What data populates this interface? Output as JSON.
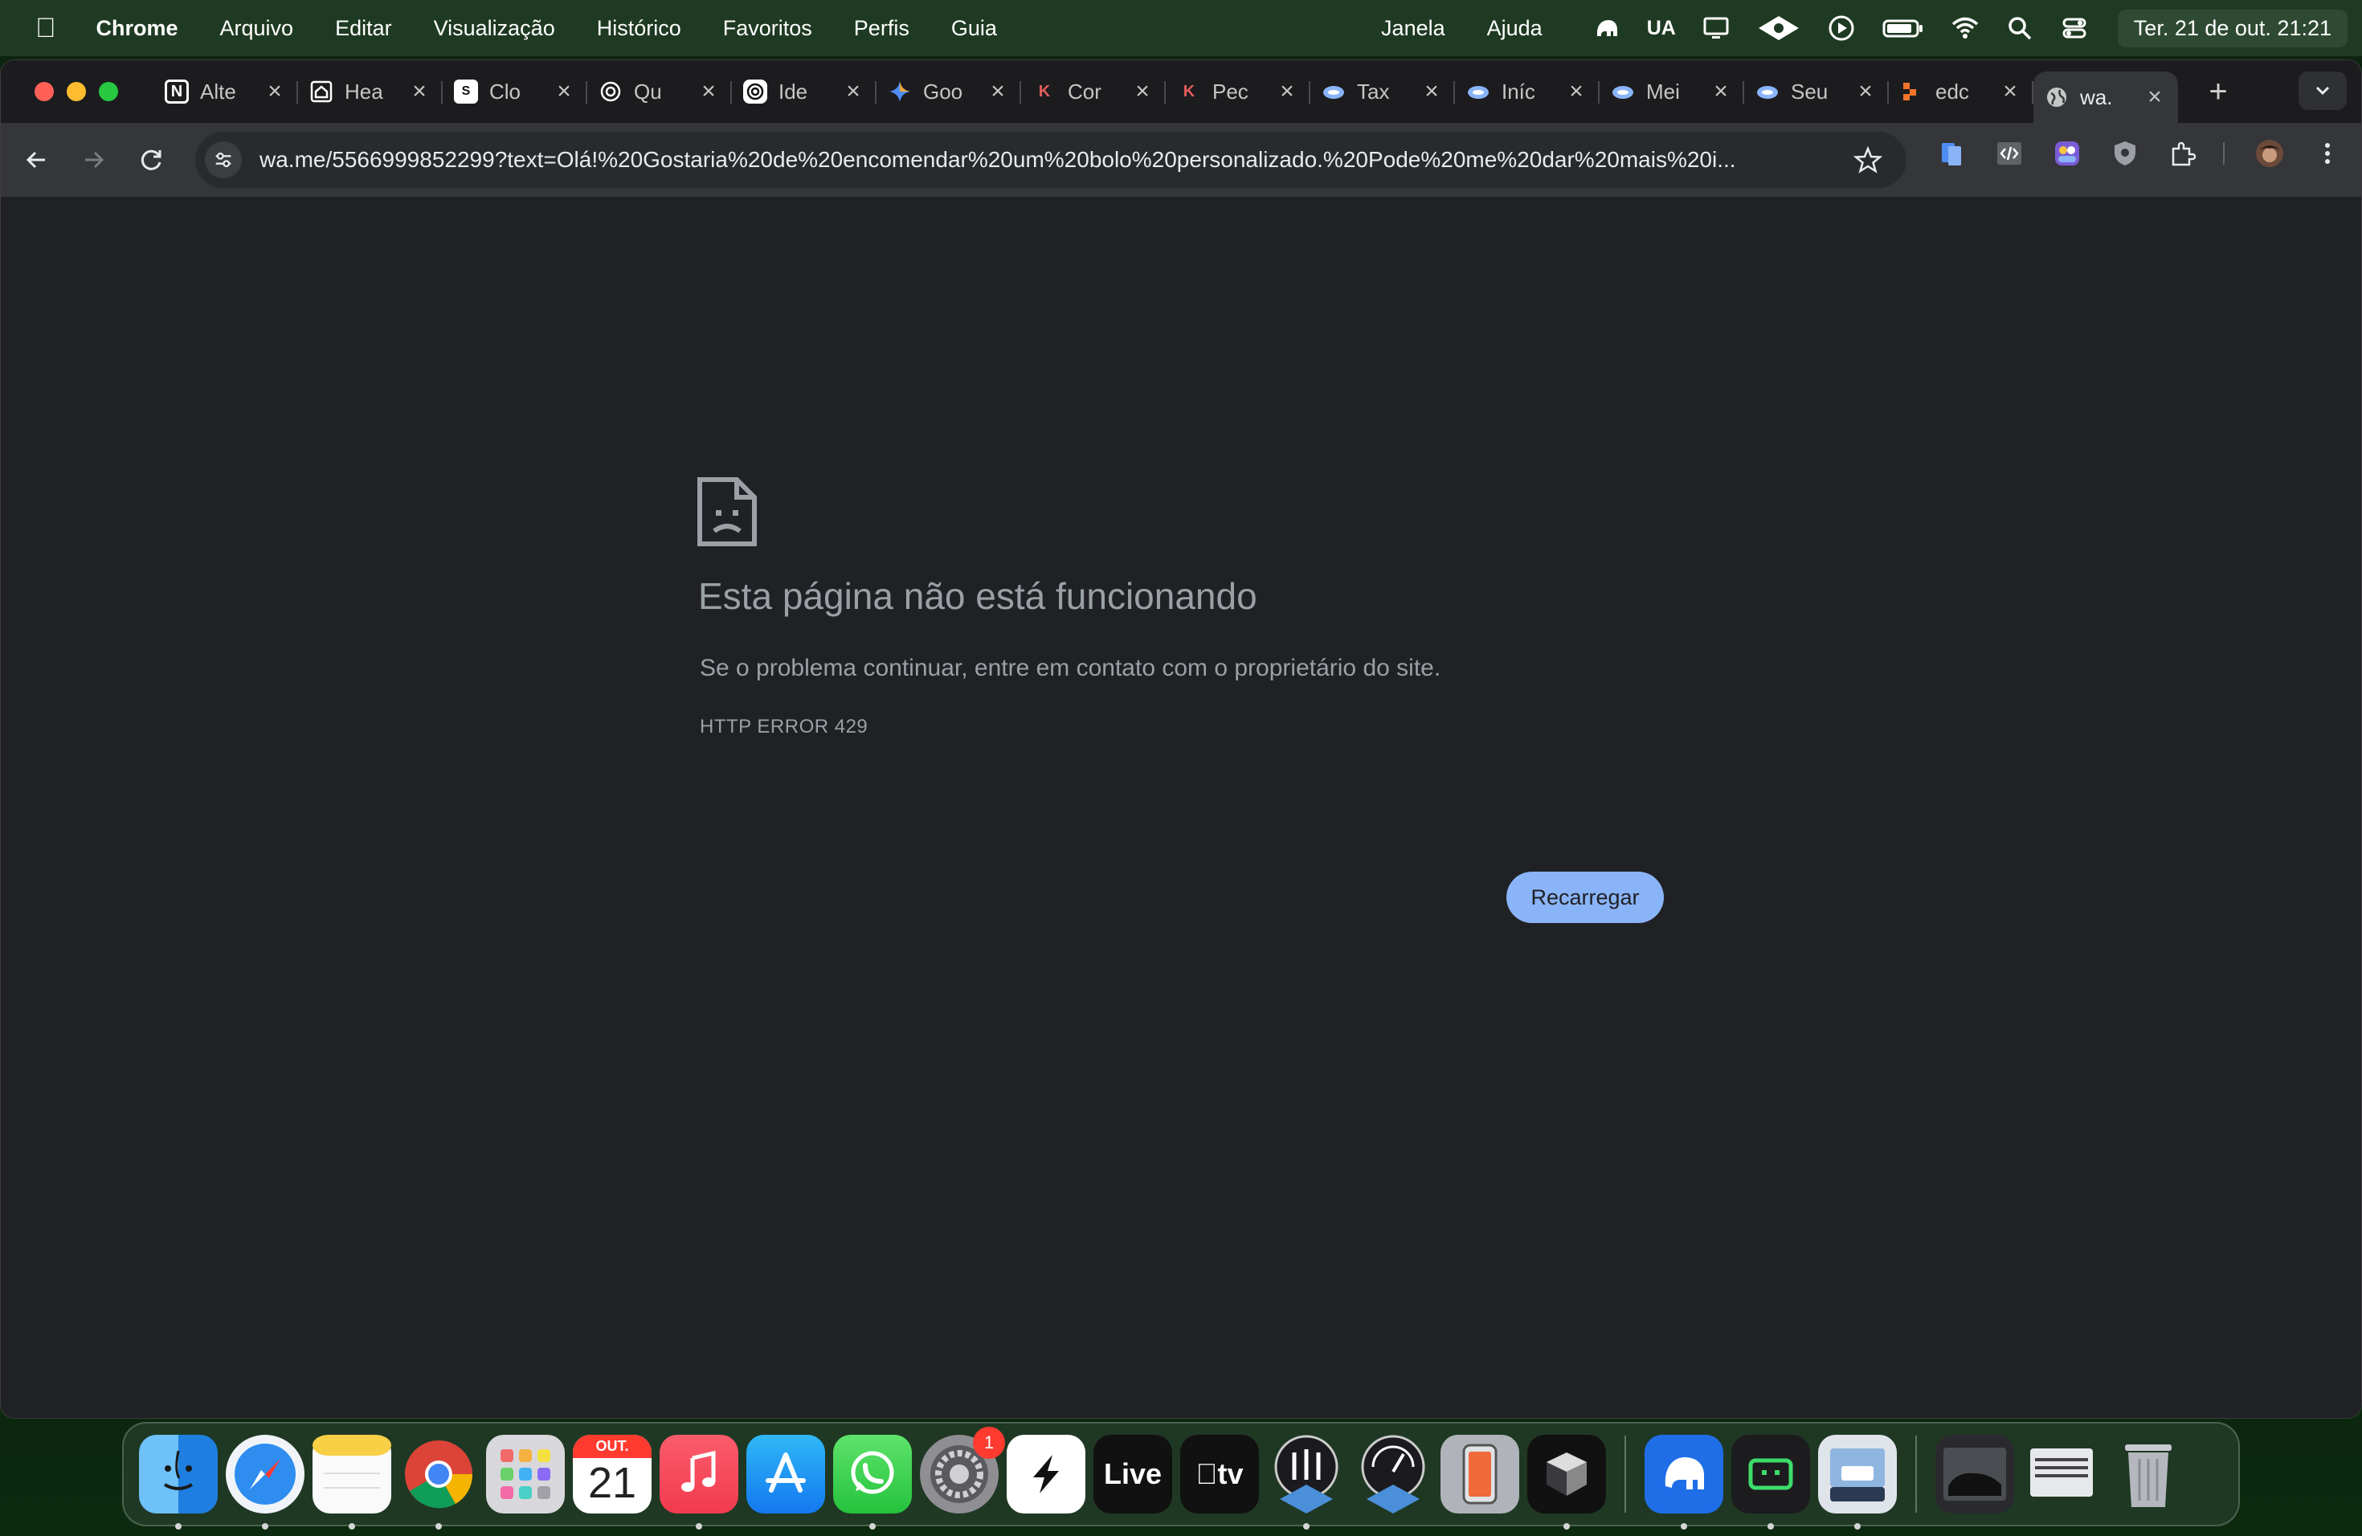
{
  "menubar": {
    "app_name": "Chrome",
    "menus": [
      "Arquivo",
      "Editar",
      "Visualização",
      "Histórico",
      "Favoritos",
      "Perfis",
      "Guia"
    ],
    "right_menus": [
      "Janela",
      "Ajuda"
    ],
    "ua_label": "UA",
    "clock": "Ter. 21 de out.  21:21"
  },
  "tabs": [
    {
      "label": "Alte",
      "icon": "notion-icon",
      "color": "#ffffff"
    },
    {
      "label": "Hea",
      "icon": "house-icon",
      "color": "#ffffff"
    },
    {
      "label": "Clo",
      "icon": "clo-icon",
      "color": "#ffffff"
    },
    {
      "label": "Qu",
      "icon": "openai-icon",
      "color": "#ffffff"
    },
    {
      "label": "Ide",
      "icon": "openai-icon",
      "color": "#ffffff"
    },
    {
      "label": "Goo",
      "icon": "gemini-icon",
      "color": "#4f8df5"
    },
    {
      "label": "Cor",
      "icon": "k-icon",
      "color": "#e35d5d"
    },
    {
      "label": "Pec",
      "icon": "k-icon",
      "color": "#e35d5d"
    },
    {
      "label": "Tax",
      "icon": "cloud-icon",
      "color": "#8ab4f8"
    },
    {
      "label": "Iníc",
      "icon": "cloud-icon",
      "color": "#8ab4f8"
    },
    {
      "label": "Mei",
      "icon": "cloud-icon",
      "color": "#8ab4f8"
    },
    {
      "label": "Seu",
      "icon": "cloud-icon",
      "color": "#8ab4f8"
    },
    {
      "label": "edc",
      "icon": "edc-icon",
      "color": "#f0742a"
    },
    {
      "label": "wa.",
      "icon": "globe-icon",
      "color": "#c4c7c5",
      "active": true
    }
  ],
  "toolbar": {
    "url": "wa.me/5566999852299?text=Olá!%20Gostaria%20de%20encomendar%20um%20bolo%20personalizado.%20Pode%20me%20dar%20mais%20i..."
  },
  "error_page": {
    "title": "Esta página não está funcionando",
    "description": "Se o problema continuar, entre em contato com o proprietário do site.",
    "code": "HTTP ERROR 429",
    "reload_label": "Recarregar"
  },
  "dock": {
    "calendar_month": "OUT.",
    "calendar_day": "21",
    "settings_badge": "1",
    "live_label": "Live",
    "tv_label": "tv"
  },
  "colors": {
    "accent": "#8ab4f8",
    "page_bg": "#202124",
    "text_muted": "#9aa0a6"
  }
}
